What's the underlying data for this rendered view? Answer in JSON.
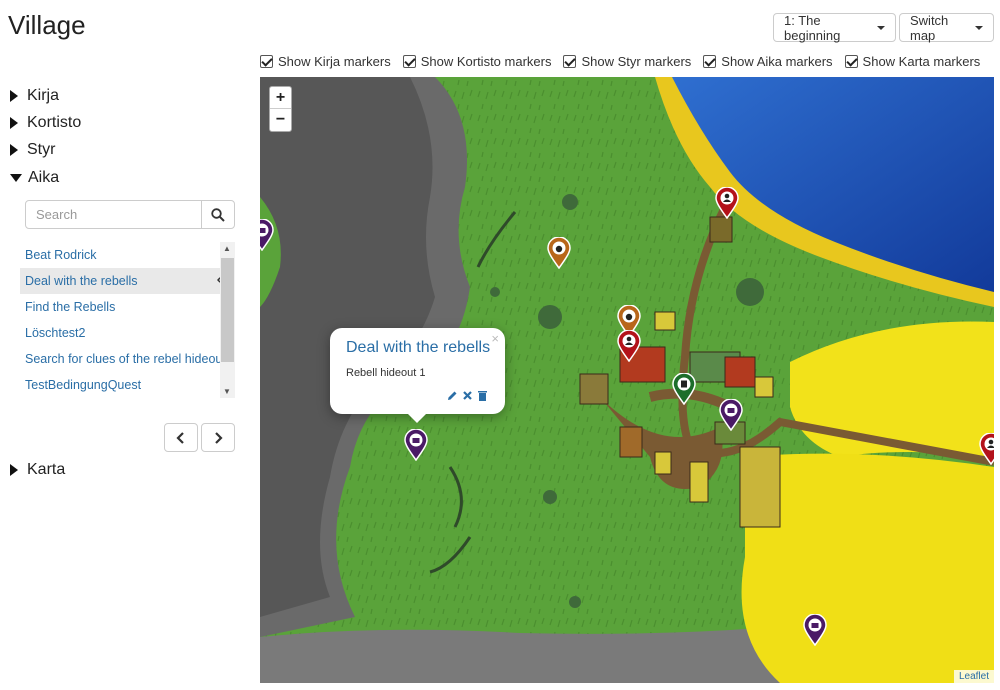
{
  "page": {
    "title": "Village"
  },
  "header": {
    "chapter_label": "1: The beginning",
    "switch_map_label": "Switch map"
  },
  "marker_toggles": [
    {
      "label": "Show Kirja markers",
      "checked": true
    },
    {
      "label": "Show Kortisto markers",
      "checked": true
    },
    {
      "label": "Show Styr markers",
      "checked": true
    },
    {
      "label": "Show Aika markers",
      "checked": true
    },
    {
      "label": "Show Karta markers",
      "checked": true
    }
  ],
  "sidebar": {
    "categories": [
      {
        "label": "Kirja",
        "expanded": false
      },
      {
        "label": "Kortisto",
        "expanded": false
      },
      {
        "label": "Styr",
        "expanded": false
      },
      {
        "label": "Aika",
        "expanded": true
      },
      {
        "label": "Karta",
        "expanded": false
      }
    ],
    "search_placeholder": "Search",
    "quests": [
      {
        "label": "Beat Rodrick",
        "active": false
      },
      {
        "label": "Deal with the rebells",
        "active": true
      },
      {
        "label": "Find the Rebells",
        "active": false
      },
      {
        "label": "Löschtest2",
        "active": false
      },
      {
        "label": "Search for clues of the rebel hideout",
        "active": false
      },
      {
        "label": "TestBedingungQuest",
        "active": false
      }
    ]
  },
  "map": {
    "zoom_in": "+",
    "zoom_out": "−",
    "attribution": "Leaflet",
    "popup": {
      "title": "Deal with the rebells",
      "text": "Rebell hideout 1",
      "close": "×"
    }
  },
  "colors": {
    "link": "#2a6ea6",
    "grass": "#5aa33a",
    "water": "#1e4fb0",
    "field": "#f2e21a",
    "marker_quest": "#4a1a66",
    "marker_person": "#b3121a",
    "marker_item": "#b8661a",
    "marker_note": "#1d6e2a"
  }
}
